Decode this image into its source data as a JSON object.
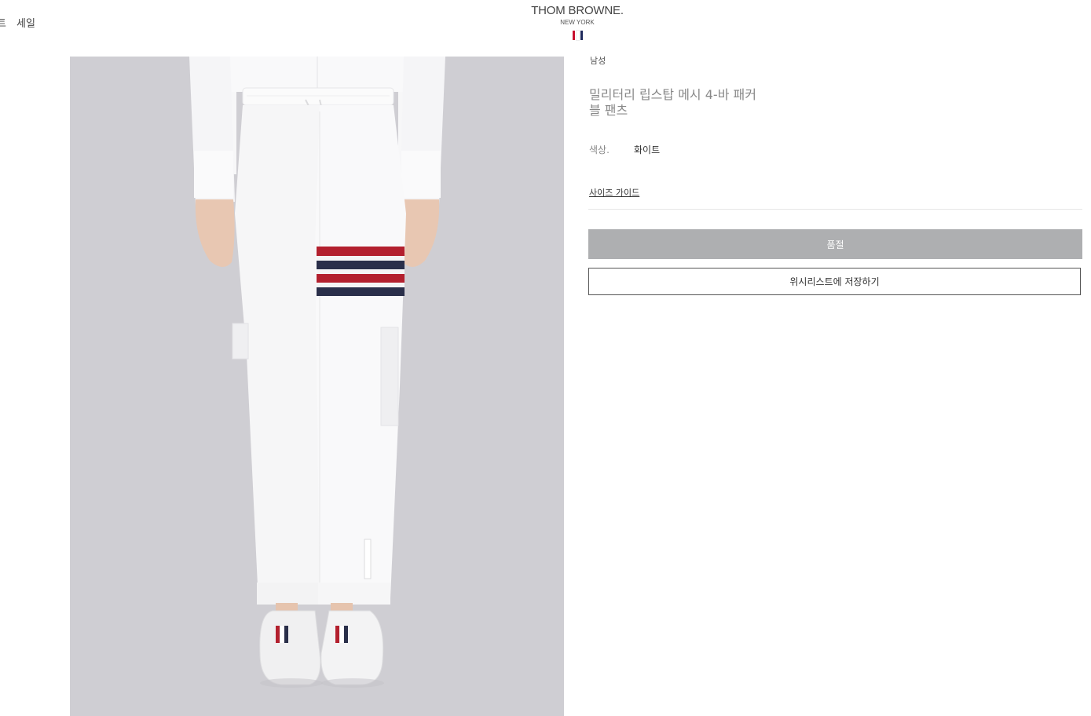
{
  "header": {
    "nav_partial": "트",
    "nav_sale": "세일",
    "logo": {
      "main": "THOM BROWNE.",
      "sub": "NEW YORK"
    },
    "flag_colors": [
      "#c8102e",
      "#ffffff",
      "#1f2a5c"
    ]
  },
  "product": {
    "category": "남성",
    "title_line1": "밀리터리 립스탑 메시 4-바 패커",
    "title_line2": "블 팬츠",
    "color_label": "색상.",
    "color_value": "화이트",
    "size_guide": "사이즈 가이드",
    "soldout_label": "품절",
    "wishlist_label": "위시리스트에 저장하기",
    "image_alt": "product-photo"
  },
  "colors": {
    "photo_bg": "#cfced3",
    "soldout_bg": "#aeafb1",
    "stripe_red": "#b3202e",
    "stripe_navy": "#2a2f4a"
  }
}
